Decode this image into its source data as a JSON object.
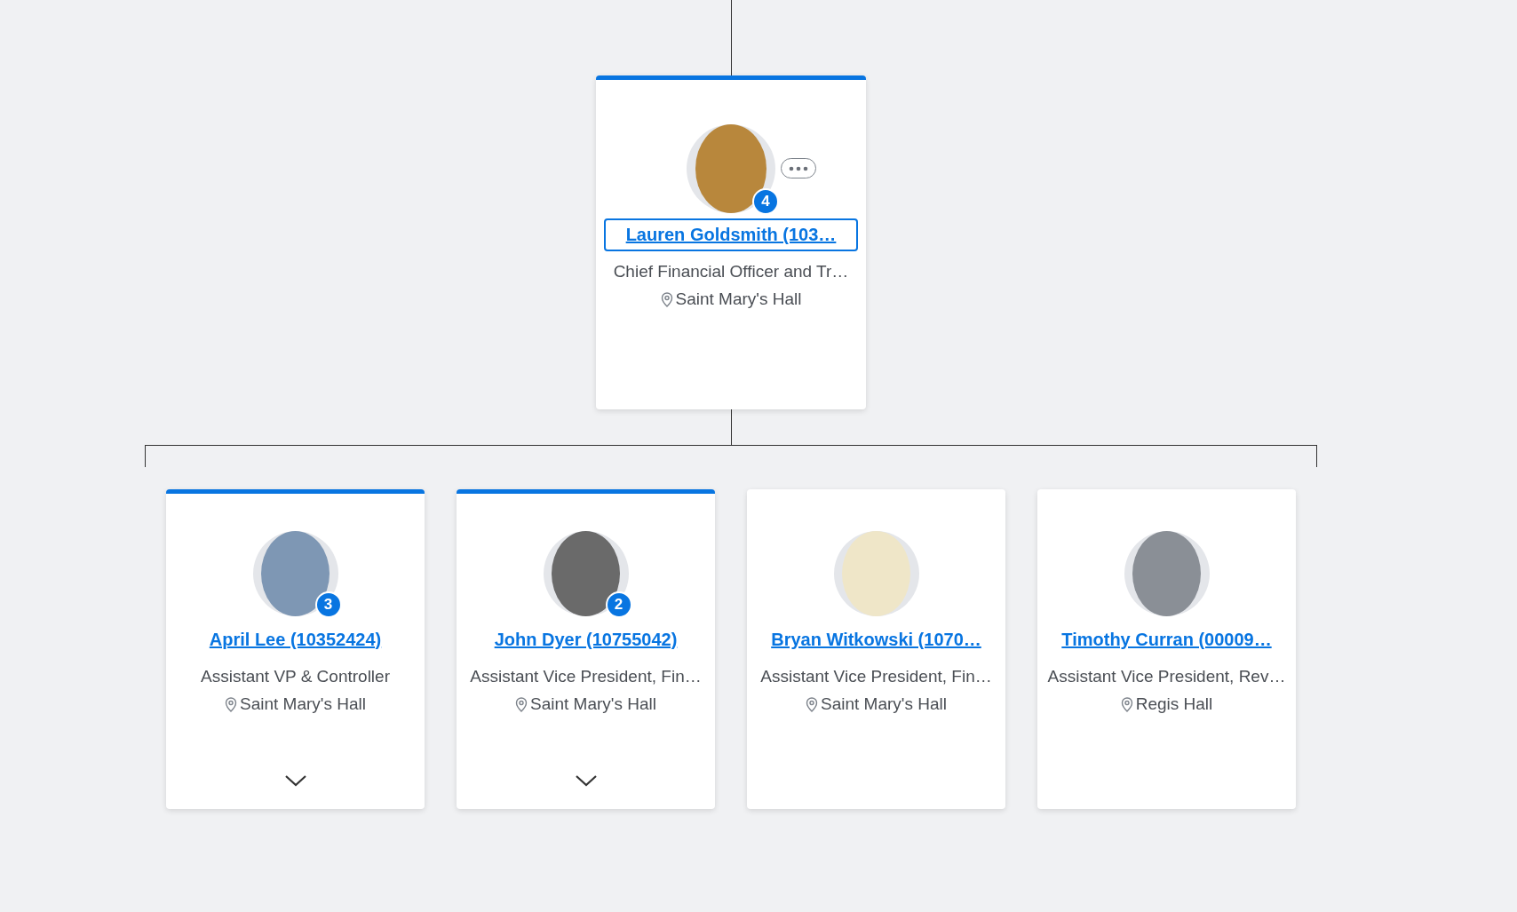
{
  "manager": {
    "name": "Lauren Goldsmith (103…",
    "title": "Chief Financial Officer and Tr…",
    "location": "Saint Mary's Hall",
    "reports_count": "4",
    "highlighted": true,
    "focused": true
  },
  "reports": [
    {
      "name": "April Lee (10352424)",
      "title": "Assistant VP & Controller",
      "location": "Saint Mary's Hall",
      "reports_count": "3",
      "highlighted": true,
      "focused": false,
      "expandable": true
    },
    {
      "name": "John Dyer (10755042)",
      "title": "Assistant Vice President, Fin…",
      "location": "Saint Mary's Hall",
      "reports_count": "2",
      "highlighted": true,
      "focused": false,
      "expandable": true
    },
    {
      "name": "Bryan Witkowski (1070…",
      "title": "Assistant Vice President, Fin…",
      "location": "Saint Mary's Hall",
      "highlighted": false,
      "focused": false,
      "expandable": false
    },
    {
      "name": "Timothy Curran (00009…",
      "title": "Assistant Vice President, Rev…",
      "location": "Regis Hall",
      "highlighted": false,
      "focused": false,
      "expandable": false
    }
  ]
}
